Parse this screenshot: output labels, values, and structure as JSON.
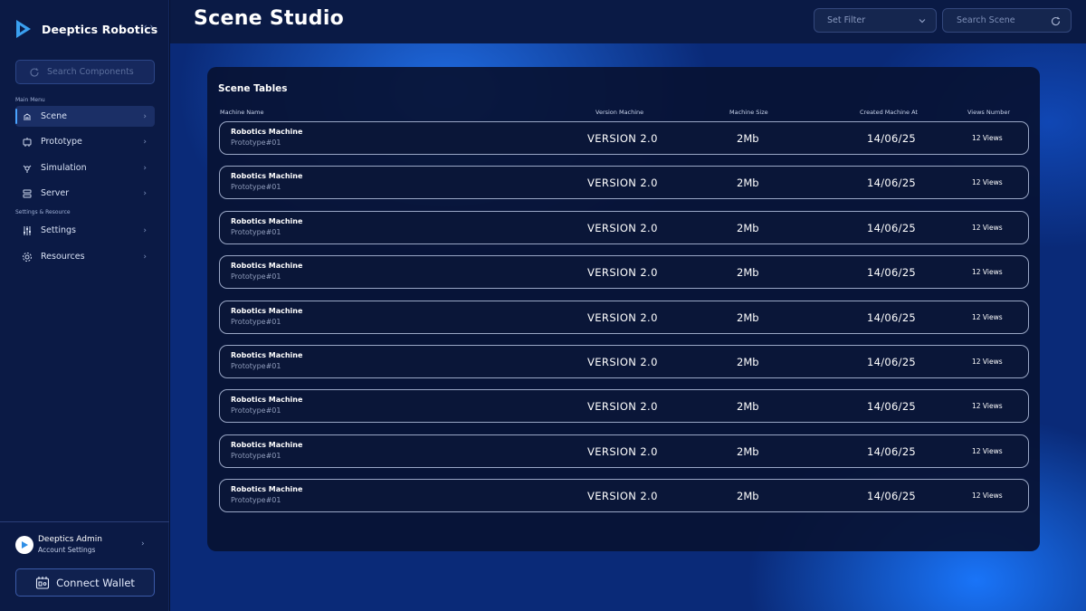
{
  "brand": {
    "name": "Deeptics Robotics",
    "collapse": "‹ ›"
  },
  "sidebar": {
    "search_placeholder": "Search Components",
    "main_menu_label": "Main Menu",
    "settings_label": "Settings & Resource",
    "main_items": [
      {
        "label": "Scene",
        "icon": "scene-icon",
        "active": true
      },
      {
        "label": "Prototype",
        "icon": "prototype-icon",
        "active": false
      },
      {
        "label": "Simulation",
        "icon": "simulation-icon",
        "active": false
      },
      {
        "label": "Server",
        "icon": "server-icon",
        "active": false
      }
    ],
    "settings_items": [
      {
        "label": "Settings",
        "icon": "sliders-icon"
      },
      {
        "label": "Resources",
        "icon": "gear-icon"
      }
    ],
    "chevron": "›"
  },
  "profile": {
    "name": "Deeptics Admin",
    "subtitle": "Account Settings",
    "chevron": "›"
  },
  "wallet": {
    "label": "Connect Wallet"
  },
  "header": {
    "title": "Scene Studio",
    "filter_label": "Set Filter",
    "search_placeholder": "Search Scene"
  },
  "table": {
    "title": "Scene Tables",
    "columns": [
      "Machine Name",
      "Version Machine",
      "Machine Size",
      "Created Machine At",
      "Views Number"
    ],
    "rows": [
      {
        "name": "Robotics Machine",
        "sub": "Prototype#01",
        "version": "VERSION 2.0",
        "size": "2Mb",
        "created": "14/06/25",
        "views": "12 Views"
      },
      {
        "name": "Robotics Machine",
        "sub": "Prototype#01",
        "version": "VERSION 2.0",
        "size": "2Mb",
        "created": "14/06/25",
        "views": "12 Views"
      },
      {
        "name": "Robotics Machine",
        "sub": "Prototype#01",
        "version": "VERSION 2.0",
        "size": "2Mb",
        "created": "14/06/25",
        "views": "12 Views"
      },
      {
        "name": "Robotics Machine",
        "sub": "Prototype#01",
        "version": "VERSION 2.0",
        "size": "2Mb",
        "created": "14/06/25",
        "views": "12 Views"
      },
      {
        "name": "Robotics Machine",
        "sub": "Prototype#01",
        "version": "VERSION 2.0",
        "size": "2Mb",
        "created": "14/06/25",
        "views": "12 Views"
      },
      {
        "name": "Robotics Machine",
        "sub": "Prototype#01",
        "version": "VERSION 2.0",
        "size": "2Mb",
        "created": "14/06/25",
        "views": "12 Views"
      },
      {
        "name": "Robotics Machine",
        "sub": "Prototype#01",
        "version": "VERSION 2.0",
        "size": "2Mb",
        "created": "14/06/25",
        "views": "12 Views"
      },
      {
        "name": "Robotics Machine",
        "sub": "Prototype#01",
        "version": "VERSION 2.0",
        "size": "2Mb",
        "created": "14/06/25",
        "views": "12 Views"
      },
      {
        "name": "Robotics Machine",
        "sub": "Prototype#01",
        "version": "VERSION 2.0",
        "size": "2Mb",
        "created": "14/06/25",
        "views": "12 Views"
      }
    ]
  },
  "colors": {
    "accent": "#4aa3ff",
    "sidebar_bg": "#0b1a45",
    "card_bg": "#081234"
  }
}
